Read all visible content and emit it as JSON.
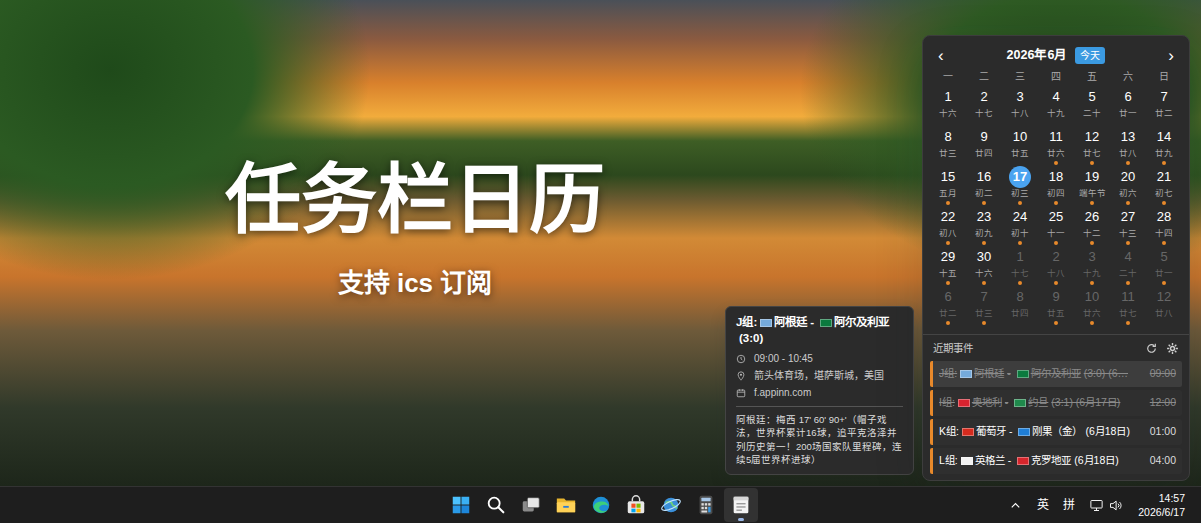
{
  "wallpaper": {
    "title": "任务栏日历",
    "subtitle": "支持 ics 订阅"
  },
  "calendar": {
    "prev": "‹",
    "month": "2026年6月",
    "today_button": "今天",
    "next": "›",
    "weekdays": [
      "一",
      "二",
      "三",
      "四",
      "五",
      "六",
      "日"
    ],
    "weeks": [
      [
        {
          "day": "1",
          "lunar": "十六",
          "event": false,
          "other_month": false,
          "selected": false
        },
        {
          "day": "2",
          "lunar": "十七",
          "event": false,
          "other_month": false,
          "selected": false
        },
        {
          "day": "3",
          "lunar": "十八",
          "event": false,
          "other_month": false,
          "selected": false
        },
        {
          "day": "4",
          "lunar": "十九",
          "event": false,
          "other_month": false,
          "selected": false
        },
        {
          "day": "5",
          "lunar": "二十",
          "event": false,
          "other_month": false,
          "selected": false
        },
        {
          "day": "6",
          "lunar": "廿一",
          "event": false,
          "other_month": false,
          "selected": false
        },
        {
          "day": "7",
          "lunar": "廿二",
          "event": false,
          "other_month": false,
          "selected": false
        }
      ],
      [
        {
          "day": "8",
          "lunar": "廿三",
          "event": false,
          "other_month": false,
          "selected": false
        },
        {
          "day": "9",
          "lunar": "廿四",
          "event": false,
          "other_month": false,
          "selected": false
        },
        {
          "day": "10",
          "lunar": "廿五",
          "event": false,
          "other_month": false,
          "selected": false
        },
        {
          "day": "11",
          "lunar": "廿六",
          "event": true,
          "other_month": false,
          "selected": false
        },
        {
          "day": "12",
          "lunar": "廿七",
          "event": true,
          "other_month": false,
          "selected": false
        },
        {
          "day": "13",
          "lunar": "廿八",
          "event": true,
          "other_month": false,
          "selected": false
        },
        {
          "day": "14",
          "lunar": "廿九",
          "event": true,
          "other_month": false,
          "selected": false
        }
      ],
      [
        {
          "day": "15",
          "lunar": "五月",
          "event": true,
          "other_month": false,
          "selected": false
        },
        {
          "day": "16",
          "lunar": "初二",
          "event": true,
          "other_month": false,
          "selected": false
        },
        {
          "day": "17",
          "lunar": "初三",
          "event": true,
          "other_month": false,
          "selected": true
        },
        {
          "day": "18",
          "lunar": "初四",
          "event": true,
          "other_month": false,
          "selected": false
        },
        {
          "day": "19",
          "lunar": "端午节",
          "event": true,
          "other_month": false,
          "selected": false
        },
        {
          "day": "20",
          "lunar": "初六",
          "event": true,
          "other_month": false,
          "selected": false
        },
        {
          "day": "21",
          "lunar": "初七",
          "event": true,
          "other_month": false,
          "selected": false
        }
      ],
      [
        {
          "day": "22",
          "lunar": "初八",
          "event": true,
          "other_month": false,
          "selected": false
        },
        {
          "day": "23",
          "lunar": "初九",
          "event": true,
          "other_month": false,
          "selected": false
        },
        {
          "day": "24",
          "lunar": "初十",
          "event": true,
          "other_month": false,
          "selected": false
        },
        {
          "day": "25",
          "lunar": "十一",
          "event": true,
          "other_month": false,
          "selected": false
        },
        {
          "day": "26",
          "lunar": "十二",
          "event": true,
          "other_month": false,
          "selected": false
        },
        {
          "day": "27",
          "lunar": "十三",
          "event": true,
          "other_month": false,
          "selected": false
        },
        {
          "day": "28",
          "lunar": "十四",
          "event": true,
          "other_month": false,
          "selected": false
        }
      ],
      [
        {
          "day": "29",
          "lunar": "十五",
          "event": true,
          "other_month": false,
          "selected": false
        },
        {
          "day": "30",
          "lunar": "十六",
          "event": true,
          "other_month": false,
          "selected": false
        },
        {
          "day": "1",
          "lunar": "十七",
          "event": true,
          "other_month": true,
          "selected": false
        },
        {
          "day": "2",
          "lunar": "十八",
          "event": true,
          "other_month": true,
          "selected": false
        },
        {
          "day": "3",
          "lunar": "十九",
          "event": true,
          "other_month": true,
          "selected": false
        },
        {
          "day": "4",
          "lunar": "二十",
          "event": true,
          "other_month": true,
          "selected": false
        },
        {
          "day": "5",
          "lunar": "廿一",
          "event": true,
          "other_month": true,
          "selected": false
        }
      ],
      [
        {
          "day": "6",
          "lunar": "廿二",
          "event": true,
          "other_month": true,
          "selected": false
        },
        {
          "day": "7",
          "lunar": "廿三",
          "event": true,
          "other_month": true,
          "selected": false
        },
        {
          "day": "8",
          "lunar": "廿四",
          "event": false,
          "other_month": true,
          "selected": false
        },
        {
          "day": "9",
          "lunar": "廿五",
          "event": true,
          "other_month": true,
          "selected": false
        },
        {
          "day": "10",
          "lunar": "廿六",
          "event": true,
          "other_month": true,
          "selected": false
        },
        {
          "day": "11",
          "lunar": "廿七",
          "event": true,
          "other_month": true,
          "selected": false
        },
        {
          "day": "12",
          "lunar": "廿八",
          "event": false,
          "other_month": true,
          "selected": false
        }
      ]
    ]
  },
  "recent": {
    "title": "近期事件"
  },
  "events": [
    {
      "match": {
        "group": "J组:",
        "teams": [
          {
            "name": "阿根廷",
            "flag": "#75aadb"
          },
          {
            "name": "阿尔及利亚",
            "flag": "#0b7a3e"
          }
        ],
        "sep": "-",
        "suffix": "(3:0) (6…"
      },
      "time": "09:00",
      "done": true,
      "hovered": true
    },
    {
      "match": {
        "group": "I组:",
        "teams": [
          {
            "name": "奥地利",
            "flag": "#d8232f"
          },
          {
            "name": "约旦",
            "flag": "#1f8a4c"
          }
        ],
        "sep": "-",
        "suffix": "(3:1) (6月17日)"
      },
      "time": "12:00",
      "done": true,
      "hovered": false
    },
    {
      "match": {
        "group": "K组:",
        "teams": [
          {
            "name": "葡萄牙",
            "flag": "#d52b1e"
          },
          {
            "name": "刚果（金）",
            "flag": "#1f7ed6"
          }
        ],
        "sep": "-",
        "suffix": "(6月18日)"
      },
      "time": "01:00",
      "done": false,
      "hovered": false
    },
    {
      "match": {
        "group": "L组:",
        "teams": [
          {
            "name": "英格兰",
            "flag": "#f2f2f2"
          },
          {
            "name": "克罗地亚",
            "flag": "#d7262c"
          }
        ],
        "sep": "-",
        "suffix": "(6月18日)"
      },
      "time": "04:00",
      "done": false,
      "hovered": false
    }
  ],
  "tooltip": {
    "match": {
      "group": "J组:",
      "teams": [
        {
          "name": "阿根廷",
          "flag": "#75aadb"
        },
        {
          "name": "阿尔及利亚",
          "flag": "#0b7a3e"
        }
      ],
      "sep": "-",
      "suffix": "(3:0)"
    },
    "time": "09:00 - 10:45",
    "location": "箭头体育场，堪萨斯城，美国",
    "source": "f.appinn.com",
    "description": "阿根廷：梅西 17' 60' 90+'（帽子戏法，世界杯累计16球，追平克洛泽并列历史第一！200场国家队里程碑，连续5届世界杯进球）"
  },
  "taskbar": {
    "apps": [
      {
        "kind": "start",
        "active": false
      },
      {
        "kind": "search",
        "active": false
      },
      {
        "kind": "task-view",
        "active": false
      },
      {
        "kind": "file-explorer",
        "active": false
      },
      {
        "kind": "edge",
        "active": false
      },
      {
        "kind": "store",
        "active": false
      },
      {
        "kind": "globe",
        "active": false
      },
      {
        "kind": "calculator",
        "active": false
      },
      {
        "kind": "calendar",
        "active": true
      }
    ],
    "tray": {
      "input_mode": "英",
      "ime": "拼",
      "time": "14:57",
      "date": "2026/6/17"
    }
  }
}
